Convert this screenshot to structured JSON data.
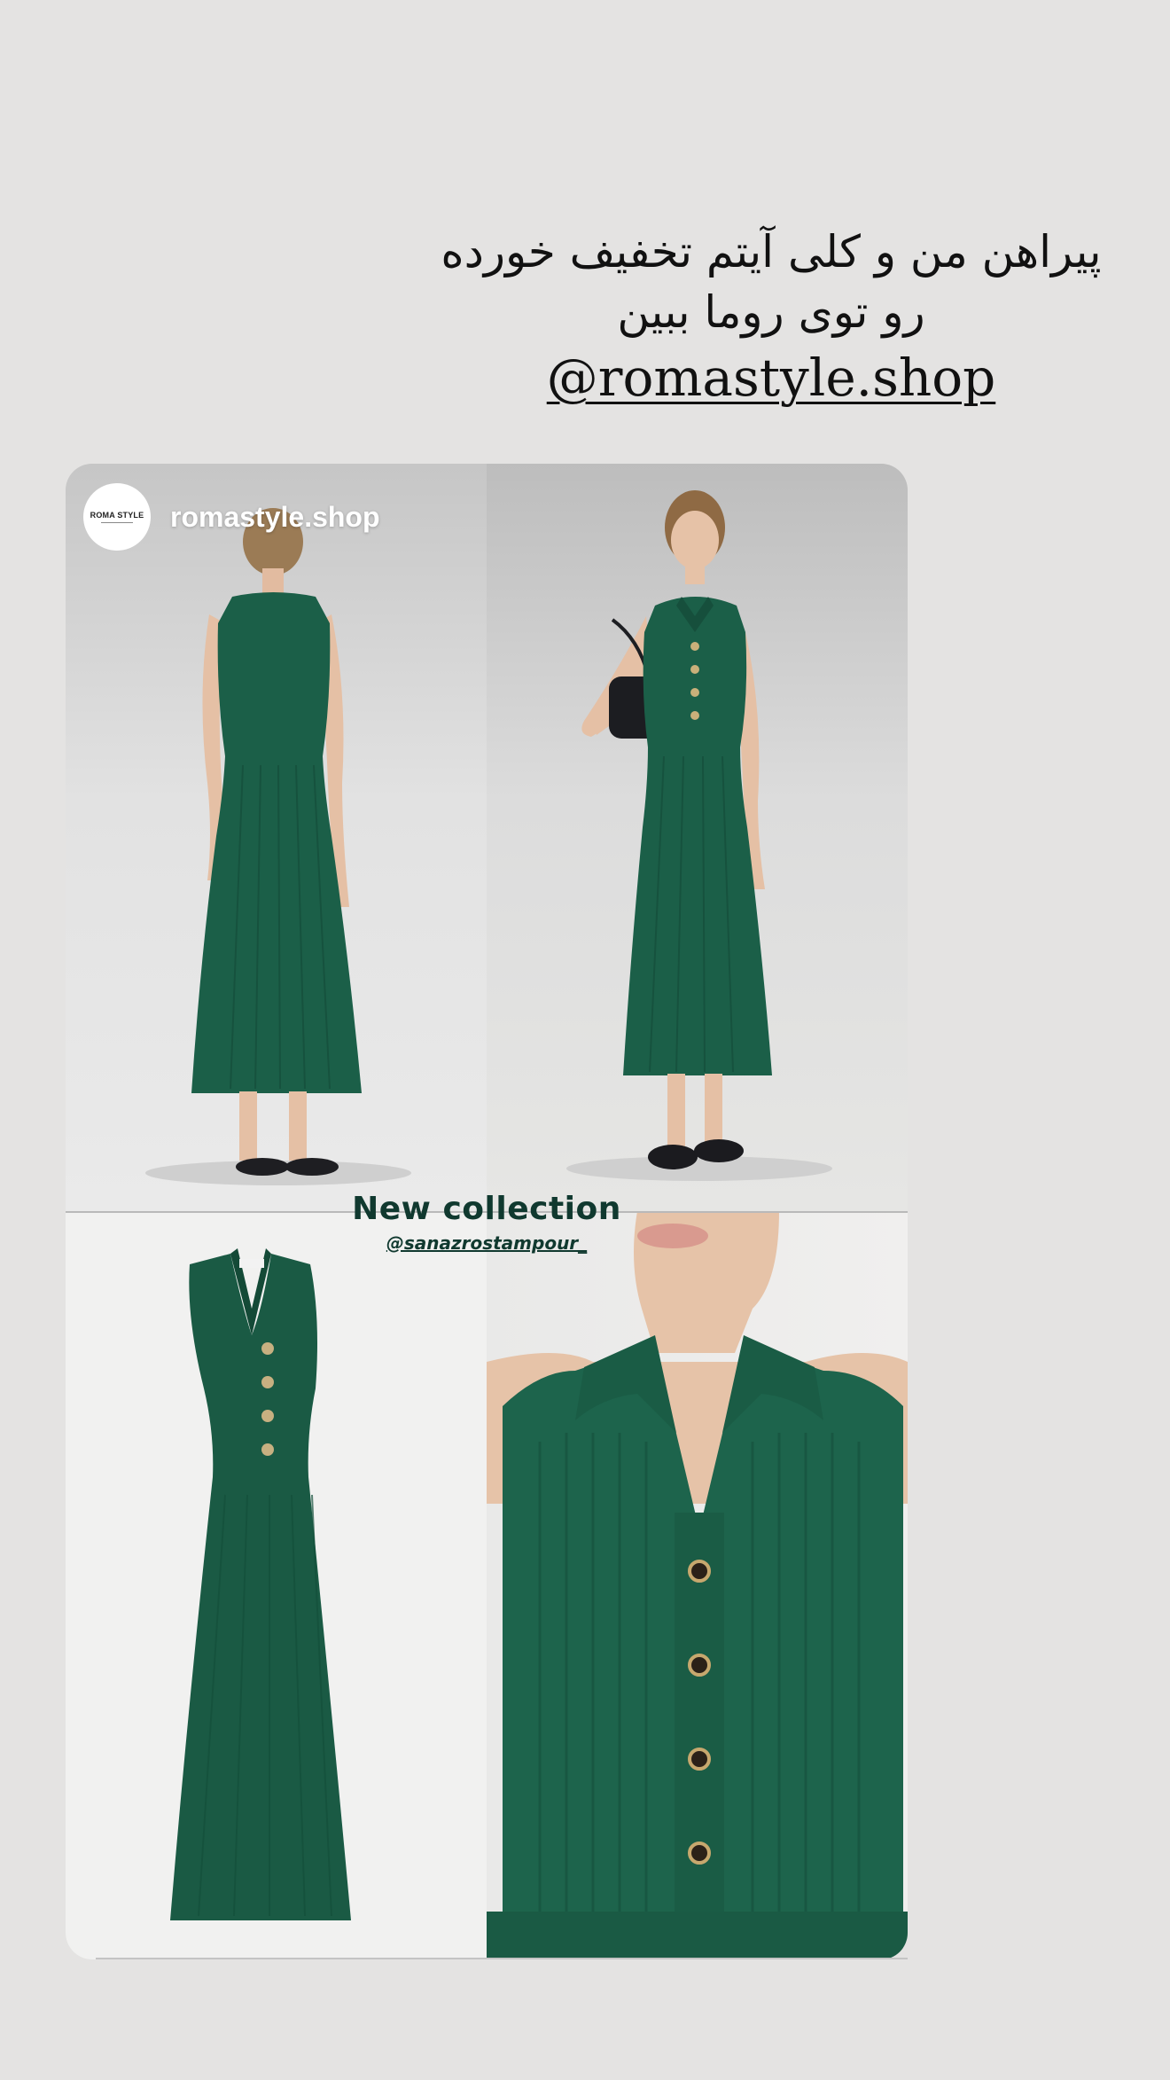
{
  "caption": {
    "line1": "پیراهن من و کلی آیتم تخفیف خورده",
    "line2": "رو توی روما ببین",
    "handle": "@romastyle.shop"
  },
  "post": {
    "username": "romastyle.shop",
    "avatar_logo_text": "ROMA STYLE",
    "overlay_title": "New collection",
    "overlay_tag": "@sanazrostampour_"
  },
  "colors": {
    "dress_green": "#1b5f48",
    "background": "#e4e3e2",
    "overlay_text": "#10392f"
  },
  "icons": {
    "avatar": "roma-style-logo"
  }
}
